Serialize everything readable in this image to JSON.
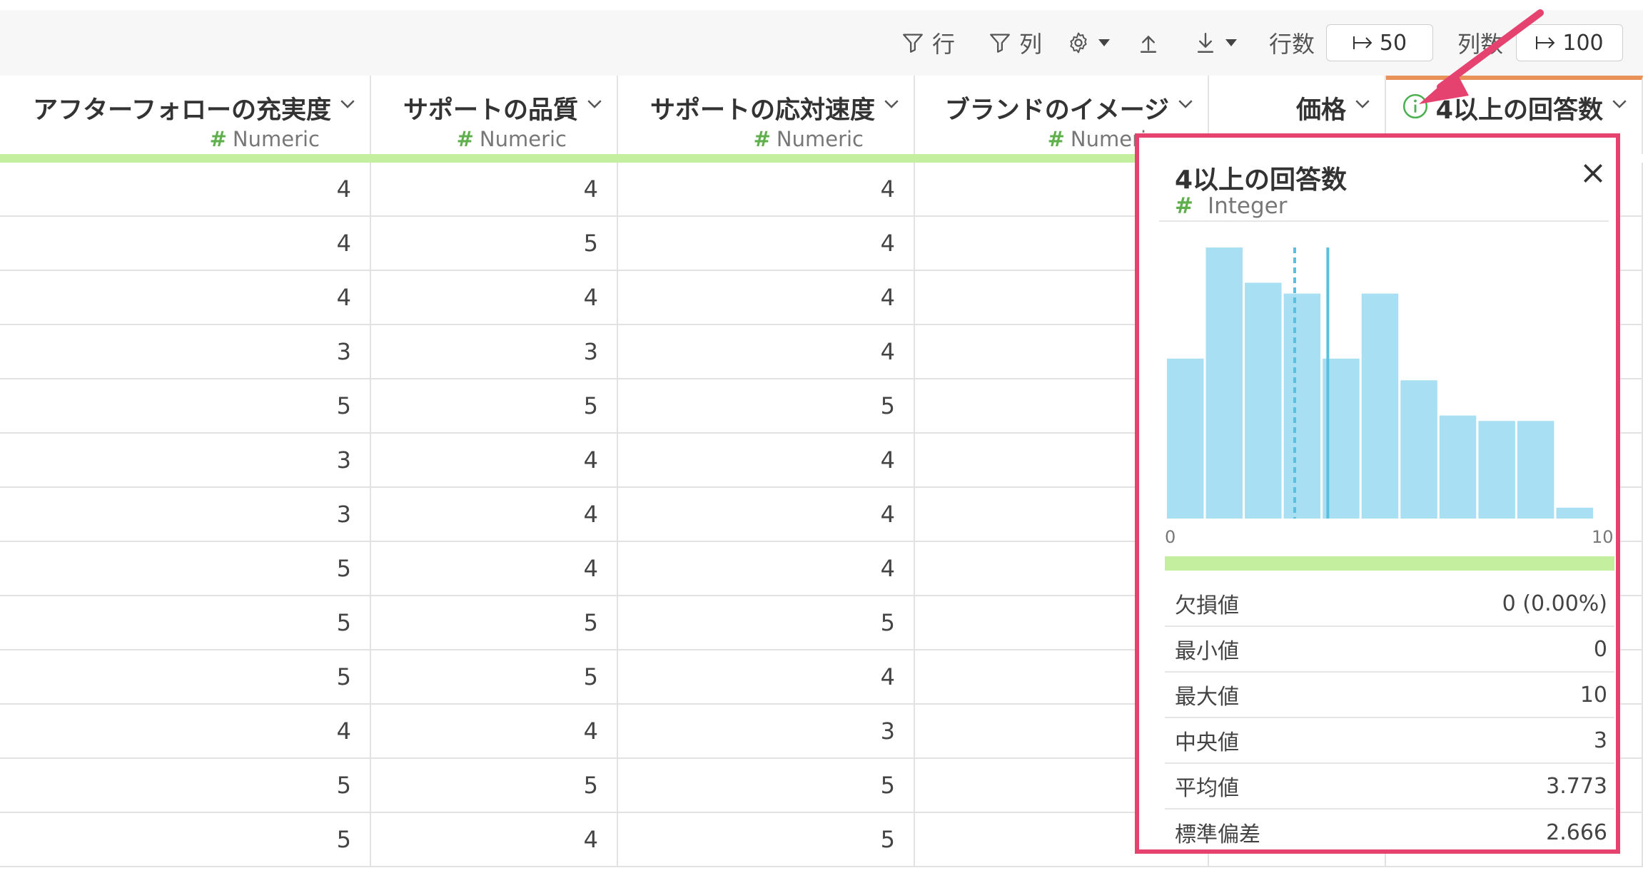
{
  "toolbar": {
    "row_filter_label": "行",
    "col_filter_label": "列",
    "rows_label": "行数",
    "rows_value": "50",
    "cols_label": "列数",
    "cols_value": "100"
  },
  "columns": [
    {
      "title": "アフターフォローの充実度",
      "type": "Numeric"
    },
    {
      "title": "サポートの品質",
      "type": "Numeric"
    },
    {
      "title": "サポートの応対速度",
      "type": "Numeric"
    },
    {
      "title": "ブランドのイメージ",
      "type": "Numeric"
    },
    {
      "title": "価格",
      "type": ""
    },
    {
      "title": "4以上の回答数",
      "type": ""
    }
  ],
  "rows": [
    [
      "4",
      "4",
      "4"
    ],
    [
      "4",
      "5",
      "4"
    ],
    [
      "4",
      "4",
      "4"
    ],
    [
      "3",
      "3",
      "4"
    ],
    [
      "5",
      "5",
      "5"
    ],
    [
      "3",
      "4",
      "4"
    ],
    [
      "3",
      "4",
      "4"
    ],
    [
      "5",
      "4",
      "4"
    ],
    [
      "5",
      "5",
      "5"
    ],
    [
      "5",
      "5",
      "4"
    ],
    [
      "4",
      "4",
      "3"
    ],
    [
      "5",
      "5",
      "5"
    ],
    [
      "5",
      "4",
      "5"
    ]
  ],
  "popover": {
    "title": "4以上の回答数",
    "type": "Integer",
    "stats": [
      {
        "label": "欠損値",
        "value": "0 (0.00%)"
      },
      {
        "label": "最小値",
        "value": "0"
      },
      {
        "label": "最大値",
        "value": "10"
      },
      {
        "label": "中央値",
        "value": "3"
      },
      {
        "label": "平均値",
        "value": "3.773"
      },
      {
        "label": "標準偏差",
        "value": "2.666"
      }
    ]
  },
  "chart_data": {
    "type": "bar",
    "x_range": [
      0,
      10
    ],
    "tick_labels": [
      "0",
      "10"
    ],
    "relative_heights": [
      0.59,
      1.0,
      0.87,
      0.83,
      0.59,
      0.83,
      0.51,
      0.38,
      0.36,
      0.36,
      0.04
    ],
    "median": 3,
    "mean": 3.773,
    "bar_color": "#a9dff2",
    "marker_color": "#5bc0e0"
  },
  "colors": {
    "accent_border": "#e5426f",
    "quality_bar": "#c3ef9f",
    "numeric_hash": "#5fb04d",
    "selected_column_top": "#e8925a"
  }
}
